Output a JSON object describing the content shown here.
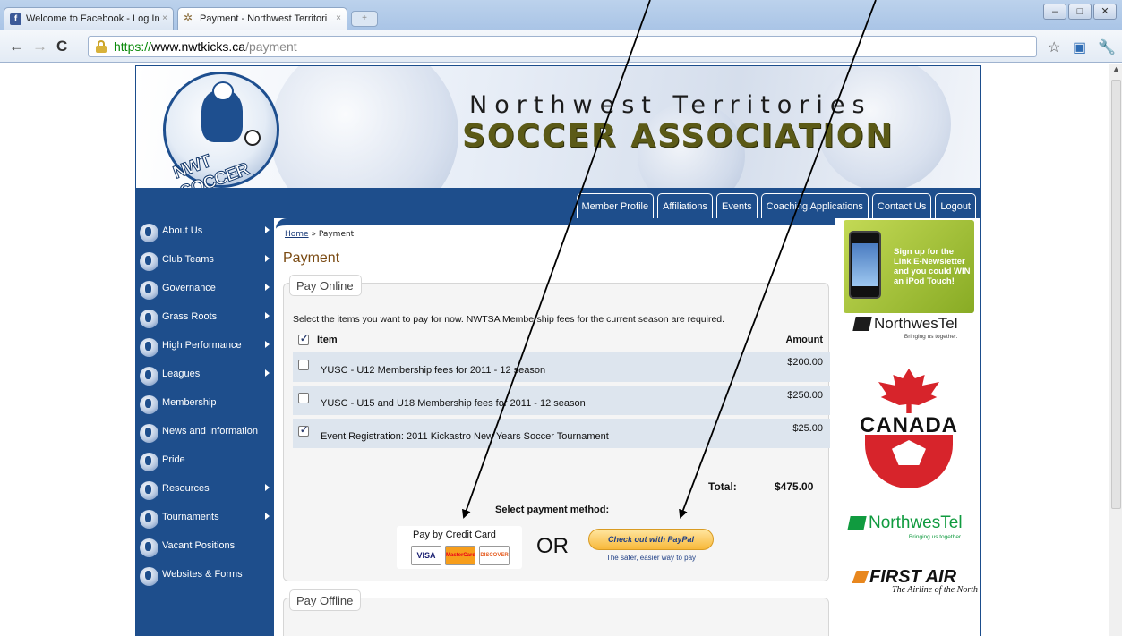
{
  "browser": {
    "tabs": [
      {
        "title": "Welcome to Facebook - Log In"
      },
      {
        "title": "Payment - Northwest Territori"
      }
    ],
    "close_glyph": "×",
    "window_buttons": [
      "–",
      "□",
      "✕"
    ],
    "url_scheme": "https://",
    "url_host": "www.nwtkicks.ca",
    "url_path": "/payment"
  },
  "header": {
    "title_line1": "Northwest Territories",
    "title_line2": "SOCCER ASSOCIATION",
    "logo_text": "NWT SOCCER"
  },
  "top_nav": [
    "Member Profile",
    "Affiliations",
    "Events",
    "Coaching Applications",
    "Contact Us",
    "Logout"
  ],
  "side_nav": [
    {
      "label": "About Us",
      "has_submenu": true
    },
    {
      "label": "Club Teams",
      "has_submenu": true
    },
    {
      "label": "Governance",
      "has_submenu": true
    },
    {
      "label": "Grass Roots",
      "has_submenu": true
    },
    {
      "label": "High Performance",
      "has_submenu": true
    },
    {
      "label": "Leagues",
      "has_submenu": true
    },
    {
      "label": "Membership",
      "has_submenu": false
    },
    {
      "label": "News and Information",
      "has_submenu": false
    },
    {
      "label": "Pride",
      "has_submenu": false
    },
    {
      "label": "Resources",
      "has_submenu": true
    },
    {
      "label": "Tournaments",
      "has_submenu": true
    },
    {
      "label": "Vacant Positions",
      "has_submenu": false
    },
    {
      "label": "Websites & Forms",
      "has_submenu": false
    }
  ],
  "breadcrumb": {
    "home": "Home",
    "separator": " » ",
    "current": "Payment"
  },
  "page_title": "Payment",
  "pay_online": {
    "legend": "Pay Online",
    "intro": "Select the items you want to pay for now. NWTSA Membership fees for the current season are required.",
    "header_item": "Item",
    "header_amount": "Amount",
    "header_checked": true,
    "rows": [
      {
        "description": "YUSC - U12 Membership fees for 2011 - 12 season",
        "amount": "$200.00",
        "checked": false
      },
      {
        "description": "YUSC - U15 and U18 Membership fees for 2011 - 12 season",
        "amount": "$250.00",
        "checked": false
      },
      {
        "description": "Event Registration: 2011 Kickastro New Years Soccer Tournament",
        "amount": "$25.00",
        "checked": true
      }
    ],
    "total_label": "Total:",
    "total_value": "$475.00",
    "select_method": "Select payment method:",
    "credit_card_label": "Pay by Credit Card",
    "cards": [
      "VISA",
      "MasterCard",
      "DISCOVER"
    ],
    "or_text": "OR",
    "paypal_label": "Check out with PayPal",
    "paypal_tagline": "The safer, easier way to pay"
  },
  "pay_offline": {
    "legend": "Pay Offline"
  },
  "ads": {
    "newsletter": "Sign up for the Link E-Newsletter and you could WIN an iPod Touch!",
    "northwestel_name": "NorthwesTel",
    "northwestel_tagline": "Bringing us together.",
    "canada": "CANADA",
    "first_air": "FIRST AIR",
    "first_air_tagline": "The Airline of the North"
  },
  "colors": {
    "site_blue": "#1e4e8c",
    "title_olive": "#5b5a17",
    "page_title_brown": "#7a4a12",
    "row_shade": "#dde5ee",
    "northwestel_green": "#109b3f",
    "canada_red": "#d7242b"
  },
  "icons": [
    "facebook-favicon",
    "soccer-favicon",
    "back-arrow-icon",
    "forward-arrow-icon",
    "reload-icon",
    "lock-icon",
    "star-icon",
    "extension-icon",
    "wrench-icon"
  ]
}
